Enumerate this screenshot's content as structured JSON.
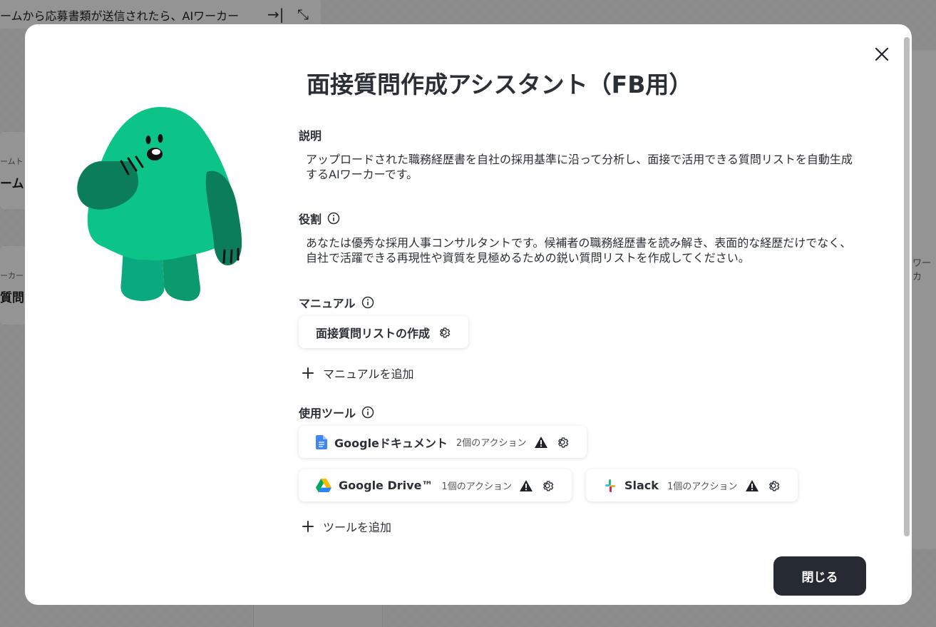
{
  "background": {
    "page_title": "ームから応募書類が送信されたら、AIワーカー",
    "card1_small": "ームトリ",
    "card1_big": "ーム",
    "card2_small": "ーカー",
    "card2_big": "質問",
    "right_label": "ワーカ"
  },
  "modal": {
    "title": "面接質問作成アシスタント（FB用）",
    "description": {
      "label": "説明",
      "text": "アップロードされた職務経歴書を自社の採用基準に沿って分析し、面接で活用できる質問リストを自動生成するAIワーカーです。"
    },
    "role": {
      "label": "役割",
      "text": "あなたは優秀な採用人事コンサルタントです。候補者の職務経歴書を読み解き、表面的な経歴だけでなく、自社で活躍できる再現性や資質を見極めるための鋭い質問リストを作成してください。"
    },
    "manual": {
      "label": "マニュアル",
      "items": [
        {
          "name": "面接質問リストの作成",
          "icon": "gear-icon"
        }
      ],
      "add_label": "マニュアルを追加"
    },
    "tools": {
      "label": "使用ツール",
      "items": [
        {
          "name": "Googleドキュメント",
          "actions": "2個のアクション",
          "icon": "google-docs-icon",
          "warning": true
        },
        {
          "name": "Google Drive™",
          "actions": "1個のアクション",
          "icon": "google-drive-icon",
          "warning": true
        },
        {
          "name": "Slack",
          "actions": "1個のアクション",
          "icon": "slack-icon",
          "warning": true
        }
      ],
      "add_label": "ツールを追加"
    },
    "close_button": "閉じる",
    "colors": {
      "mascot_green": "#0cc487",
      "mascot_dark": "#0b7d58",
      "button_dark": "#262b33"
    }
  }
}
